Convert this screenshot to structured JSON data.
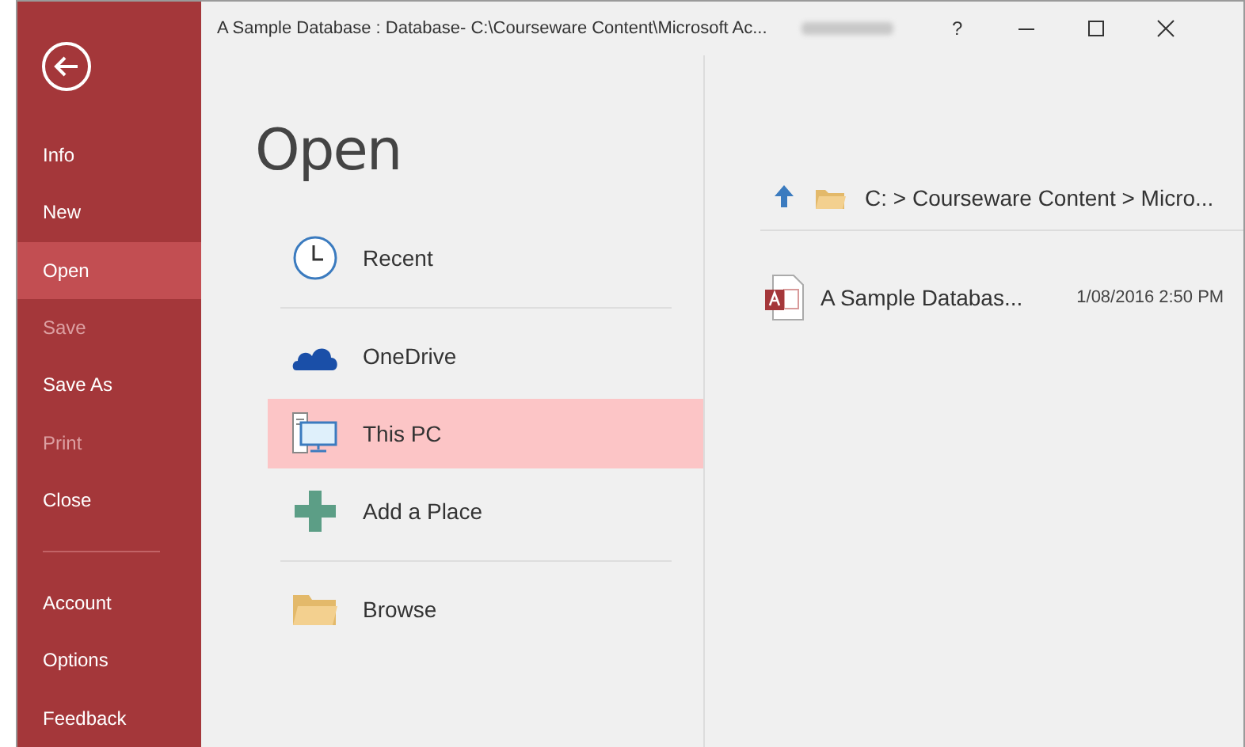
{
  "window": {
    "title": "A Sample Database : Database- C:\\Courseware Content\\Microsoft Ac...",
    "controls": [
      "?"
    ]
  },
  "sidebar": {
    "items": [
      {
        "label": "Info",
        "selected": false,
        "disabled": false
      },
      {
        "label": "New",
        "selected": false,
        "disabled": false
      },
      {
        "label": "Open",
        "selected": true,
        "disabled": false
      },
      {
        "label": "Save",
        "selected": false,
        "disabled": true
      },
      {
        "label": "Save As",
        "selected": false,
        "disabled": false
      },
      {
        "label": "Print",
        "selected": false,
        "disabled": true
      },
      {
        "label": "Close",
        "selected": false,
        "disabled": false
      }
    ],
    "footer_items": [
      {
        "label": "Account"
      },
      {
        "label": "Options"
      },
      {
        "label": "Feedback"
      }
    ]
  },
  "heading": "Open",
  "places": [
    [
      {
        "label": "Recent",
        "kind": "clock",
        "selected": false
      }
    ],
    [
      {
        "label": "OneDrive",
        "kind": "cloud",
        "selected": false
      },
      {
        "label": "This PC",
        "kind": "pc",
        "selected": true
      },
      {
        "label": "Add a Place",
        "kind": "plus",
        "selected": false
      }
    ],
    [
      {
        "label": "Browse",
        "kind": "folder",
        "selected": false
      }
    ]
  ],
  "path": "C: > Courseware Content > Micro...",
  "files": [
    {
      "name": "A Sample Databas...",
      "date": "1/08/2016 2:50 PM"
    }
  ]
}
